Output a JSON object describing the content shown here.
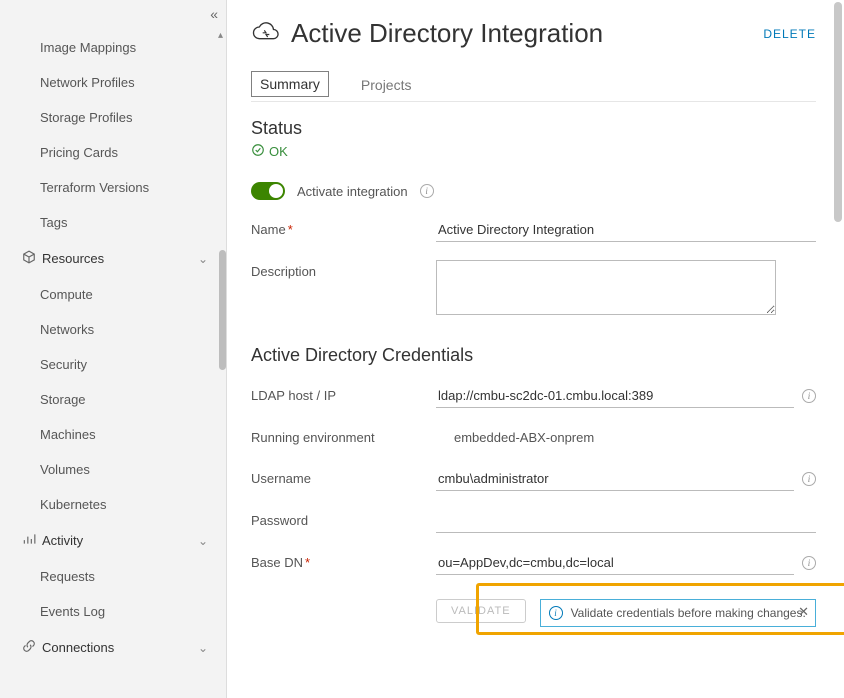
{
  "sidebar": {
    "plain_items_top": [
      "Image Mappings",
      "Network Profiles",
      "Storage Profiles",
      "Pricing Cards",
      "Terraform Versions",
      "Tags"
    ],
    "group_resources": {
      "label": "Resources",
      "icon": "cube-icon"
    },
    "resources_items": [
      "Compute",
      "Networks",
      "Security",
      "Storage",
      "Machines",
      "Volumes",
      "Kubernetes"
    ],
    "group_activity": {
      "label": "Activity",
      "icon": "chart-icon"
    },
    "activity_items": [
      "Requests",
      "Events Log"
    ],
    "group_connections": {
      "label": "Connections",
      "icon": "link-icon"
    }
  },
  "page": {
    "title": "Active Directory Integration",
    "delete": "DELETE"
  },
  "tabs": {
    "summary": "Summary",
    "projects": "Projects"
  },
  "status": {
    "heading": "Status",
    "text": "OK"
  },
  "toggle": {
    "label": "Activate integration"
  },
  "form": {
    "name_label": "Name",
    "name_value": "Active Directory Integration",
    "desc_label": "Description",
    "desc_value": ""
  },
  "credentials": {
    "heading": "Active Directory Credentials",
    "ldap_label": "LDAP host / IP",
    "ldap_value": "ldap://cmbu-sc2dc-01.cmbu.local:389",
    "env_label": "Running environment",
    "env_value": "embedded-ABX-onprem",
    "user_label": "Username",
    "user_value": "cmbu\\administrator",
    "pass_label": "Password",
    "pass_value": "",
    "basedn_label": "Base DN",
    "basedn_value": "ou=AppDev,dc=cmbu,dc=local"
  },
  "validate": {
    "button": "VALIDATE",
    "message": "Validate credentials before making changes."
  }
}
